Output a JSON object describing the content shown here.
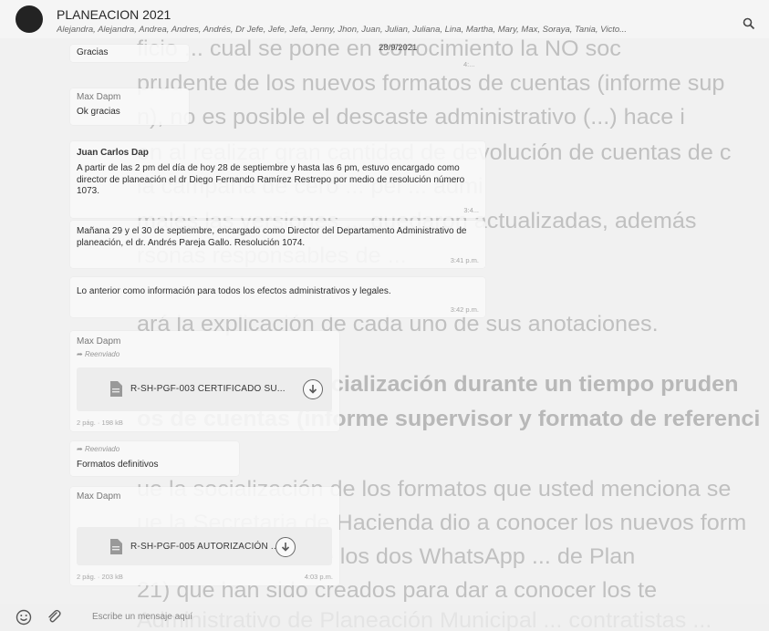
{
  "header": {
    "title": "PLANEACION 2021",
    "members": "Alejandra, Alejandra, Andrea, Andres, Andrés, Dr Jefe, Jefe, Jefa, Jenny, Jhon, Juan, Julian, Juliana, Lina, Martha, Mary, Max, Soraya, Tania, Victo..."
  },
  "background_doc": [
    "ficio ... cual se pone en conocimiento la NO soc",
    "prudente de los nuevos formatos de cuentas (informe sup",
    "n), no es posible el descaste administrativo (...) hace i",
    "on al realizar gran cantidad de devolución de cuentas de c",
    "la campaña de cero ... pel ... admi",
    "males las versiones ... quedaron actualizadas, además",
    "rsonas responsables de ...",
    "ará la explicación de cada uno de sus anotaciones.",
    "cimiento la NO socialización durante un tiempo pruden",
    "os de cuentas (informe supervisor y formato de referenci",
    "ue la socialización de los formatos que usted menciona se",
    "ue la Secretaria de Hacienda dio a conocer los nuevos form",
    "licación a través de los dos WhatsApp ... de Plan",
    "21) que han sido creados para dar a conocer los te",
    "Administrativo de Planeación Municipal ... contratistas ..."
  ],
  "messages": {
    "m1_text": "Gracias",
    "m1_date": "28/9/2021",
    "m1_time": "4:...",
    "m2_sender": "Max Dapm",
    "m2_text": "Ok gracias",
    "m2_time": "...",
    "m3_sender": "Juan Carlos Dap",
    "m3_text": "A partir de las 2 pm del día de hoy 28 de septiembre y hasta las 6 pm, estuvo encargado como director de planeación el dr Diego Fernando Ramírez Restrepo por medio de resolución número 1073.",
    "m3_time": "3:4...",
    "m4_text": "Mañana 29 y el 30 de septiembre, encargado como Director del Departamento Administrativo de planeación, el dr. Andrés Pareja Gallo. Resolución 1074.",
    "m4_time": "3:41 p.m.",
    "m5_text": "Lo anterior como información para todos los efectos administrativos y legales.",
    "m5_time": "3:42 p.m.",
    "m6_sender": "Max Dapm",
    "m6_forward": "Reenviado",
    "m6_file": "R-SH-PGF-003 CERTIFICADO SU...",
    "m6_meta": "2 pág. · 198 kB",
    "m7_forward": "Reenviado",
    "m7_text": "Formatos definitivos",
    "m8_sender": "Max Dapm",
    "m8_file": "R-SH-PGF-005 AUTORIZACIÓN ...",
    "m8_meta": "2 pág. · 203 kB",
    "m8_time": "4:03 p.m."
  },
  "composer": {
    "placeholder": "Escribe un mensaje aquí"
  },
  "icons": {
    "search": "search-icon",
    "emoji": "emoji-icon",
    "attach": "paperclip-icon",
    "pdf": "pdf-file-icon",
    "download": "download-icon"
  }
}
